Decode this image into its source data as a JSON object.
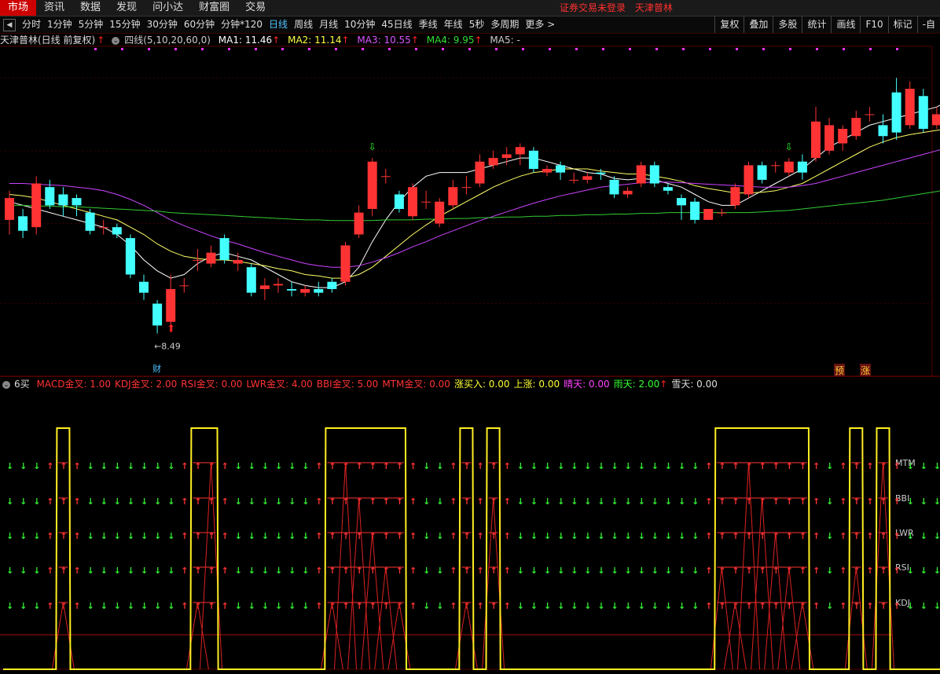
{
  "menu": {
    "items": [
      "市场",
      "资讯",
      "数据",
      "发现",
      "问小达",
      "财富圈",
      "交易"
    ],
    "active": 0,
    "notice_left": "证券交易未登录",
    "notice_right": "天津普林"
  },
  "toolbar": {
    "periods": [
      "分时",
      "1分钟",
      "5分钟",
      "15分钟",
      "30分钟",
      "60分钟",
      "分钟*120",
      "日线",
      "周线",
      "月线",
      "10分钟",
      "45日线",
      "季线",
      "年线",
      "5秒",
      "多周期",
      "更多 >"
    ],
    "active": "日线",
    "right_buttons": [
      "复权",
      "叠加",
      "多股",
      "统计",
      "画线",
      "F10",
      "标记",
      "-自"
    ]
  },
  "header": {
    "stock": "天津普林(日线 前复权)",
    "indicator": "四线(5,10,20,60,0)",
    "ma1": "MA1: 11.46",
    "ma2": "MA2: 11.14",
    "ma3": "MA3: 10.55",
    "ma4": "MA4: 9.95",
    "ma5": "MA5: -"
  },
  "sub_header": {
    "name": "6买",
    "fields": [
      {
        "text": "MACD金叉: 1.00",
        "color": "#ff3333"
      },
      {
        "text": "KDJ金叉: 2.00",
        "color": "#ff3333"
      },
      {
        "text": "RSI金叉: 0.00",
        "color": "#ff3333"
      },
      {
        "text": "LWR金叉: 4.00",
        "color": "#ff3333"
      },
      {
        "text": "BBI金叉: 5.00",
        "color": "#ff3333"
      },
      {
        "text": "MTM金叉: 0.00",
        "color": "#ff3333"
      },
      {
        "text": "涨买入: 0.00",
        "color": "#ffff33"
      },
      {
        "text": "上涨: 0.00",
        "color": "#ffff33"
      },
      {
        "text": "晴天: 0.00",
        "color": "#ff44ff"
      },
      {
        "text": "雨天: 2.00",
        "color": "#33ff33"
      },
      {
        "text": "雪天: 0.00",
        "color": "#dddddd"
      }
    ]
  },
  "annotations": {
    "high": "12.02",
    "low": "8.49",
    "cai": "财",
    "yu": "预",
    "zhang": "涨"
  },
  "sub_labels": [
    "MTM",
    "BBI",
    "LWR",
    "RSI",
    "KDJ"
  ],
  "chart_data": {
    "type": "candlestick",
    "ylim": [
      8.0,
      12.4
    ],
    "candles": [
      [
        10.05,
        10.35,
        10.45,
        9.85
      ],
      [
        10.1,
        9.9,
        10.2,
        9.8
      ],
      [
        9.95,
        10.55,
        10.65,
        9.85
      ],
      [
        10.5,
        10.25,
        10.6,
        10.2
      ],
      [
        10.4,
        10.25,
        10.5,
        10.1
      ],
      [
        10.35,
        10.25,
        10.4,
        10.1
      ],
      [
        10.15,
        9.9,
        10.2,
        9.85
      ],
      [
        9.95,
        9.95,
        10.05,
        9.85
      ],
      [
        9.95,
        9.85,
        10.0,
        9.8
      ],
      [
        9.8,
        9.3,
        9.85,
        9.25
      ],
      [
        9.2,
        9.05,
        9.3,
        8.95
      ],
      [
        8.9,
        8.6,
        8.95,
        8.49
      ],
      [
        8.65,
        9.1,
        9.3,
        8.6
      ],
      [
        9.15,
        9.15,
        9.25,
        9.05
      ],
      [
        9.5,
        9.5,
        9.65,
        9.35
      ],
      [
        9.45,
        9.6,
        9.7,
        9.4
      ],
      [
        9.8,
        9.5,
        9.85,
        9.45
      ],
      [
        9.45,
        9.5,
        9.6,
        9.35
      ],
      [
        9.4,
        9.05,
        9.45,
        9.0
      ],
      [
        9.1,
        9.15,
        9.25,
        8.95
      ],
      [
        9.15,
        9.17,
        9.25,
        9.05
      ],
      [
        9.1,
        9.08,
        9.2,
        9.0
      ],
      [
        9.05,
        9.1,
        9.15,
        9.0
      ],
      [
        9.1,
        9.05,
        9.2,
        9.0
      ],
      [
        9.2,
        9.1,
        9.25,
        9.05
      ],
      [
        9.2,
        9.7,
        9.75,
        9.15
      ],
      [
        9.85,
        10.15,
        10.25,
        9.8
      ],
      [
        10.2,
        10.85,
        10.9,
        10.1
      ],
      [
        10.65,
        10.65,
        10.75,
        10.55
      ],
      [
        10.4,
        10.2,
        10.45,
        10.15
      ],
      [
        10.1,
        10.5,
        10.55,
        10.05
      ],
      [
        10.3,
        10.3,
        10.45,
        10.2
      ],
      [
        10.0,
        10.3,
        10.35,
        9.95
      ],
      [
        10.25,
        10.5,
        10.6,
        10.2
      ],
      [
        10.5,
        10.5,
        10.65,
        10.4
      ],
      [
        10.55,
        10.85,
        10.95,
        10.5
      ],
      [
        10.8,
        10.9,
        11.0,
        10.75
      ],
      [
        10.9,
        10.95,
        11.05,
        10.8
      ],
      [
        10.95,
        11.05,
        11.1,
        10.8
      ],
      [
        11.0,
        10.75,
        11.05,
        10.7
      ],
      [
        10.7,
        10.75,
        10.8,
        10.65
      ],
      [
        10.8,
        10.7,
        10.85,
        10.6
      ],
      [
        10.6,
        10.6,
        10.7,
        10.55
      ],
      [
        10.6,
        10.65,
        10.7,
        10.55
      ],
      [
        10.7,
        10.68,
        10.75,
        10.6
      ],
      [
        10.6,
        10.4,
        10.65,
        10.35
      ],
      [
        10.4,
        10.45,
        10.5,
        10.35
      ],
      [
        10.55,
        10.8,
        10.85,
        10.5
      ],
      [
        10.8,
        10.55,
        10.85,
        10.5
      ],
      [
        10.5,
        10.45,
        10.55,
        10.4
      ],
      [
        10.35,
        10.25,
        10.4,
        10.05
      ],
      [
        10.3,
        10.05,
        10.35,
        10.0
      ],
      [
        10.05,
        10.2,
        10.2,
        10.05
      ],
      [
        10.15,
        10.15,
        10.2,
        10.1
      ],
      [
        10.25,
        10.5,
        10.55,
        10.2
      ],
      [
        10.4,
        10.8,
        10.85,
        10.35
      ],
      [
        10.8,
        10.6,
        10.85,
        10.55
      ],
      [
        10.8,
        10.8,
        10.85,
        10.7
      ],
      [
        10.7,
        10.85,
        10.9,
        10.65
      ],
      [
        10.85,
        10.7,
        10.95,
        10.6
      ],
      [
        10.9,
        11.4,
        11.6,
        10.85
      ],
      [
        11.0,
        11.35,
        11.45,
        10.95
      ],
      [
        11.1,
        11.3,
        11.35,
        11.0
      ],
      [
        11.2,
        11.45,
        11.55,
        11.15
      ],
      [
        11.5,
        11.5,
        11.6,
        11.4
      ],
      [
        11.35,
        11.2,
        11.5,
        11.1
      ],
      [
        11.8,
        11.25,
        12.0,
        11.15
      ],
      [
        11.35,
        11.85,
        11.95,
        11.3
      ],
      [
        11.75,
        11.3,
        11.85,
        11.25
      ],
      [
        11.35,
        11.5,
        11.6,
        11.3
      ],
      [
        11.6,
        12.02,
        12.02,
        11.55
      ],
      [
        11.9,
        11.75,
        12.0,
        11.6
      ],
      [
        11.7,
        11.6,
        11.9,
        11.5
      ]
    ],
    "ma": {
      "MA1": {
        "color": "#ffffff",
        "values": [
          10.3,
          10.25,
          10.2,
          10.15,
          10.1,
          10.05,
          10.0,
          9.95,
          9.85,
          9.7,
          9.5,
          9.35,
          9.25,
          9.3,
          9.45,
          9.55,
          9.6,
          9.55,
          9.5,
          9.4,
          9.3,
          9.2,
          9.15,
          9.12,
          9.12,
          9.2,
          9.4,
          9.75,
          10.05,
          10.3,
          10.5,
          10.65,
          10.7,
          10.7,
          10.7,
          10.75,
          10.8,
          10.85,
          10.9,
          10.9,
          10.85,
          10.8,
          10.75,
          10.7,
          10.68,
          10.62,
          10.6,
          10.62,
          10.6,
          10.55,
          10.5,
          10.4,
          10.3,
          10.25,
          10.25,
          10.35,
          10.45,
          10.55,
          10.65,
          10.75,
          10.9,
          11.05,
          11.15,
          11.25,
          11.35,
          11.4,
          11.45,
          11.5,
          11.55,
          11.6,
          11.7,
          11.75,
          11.75
        ]
      },
      "MA2": {
        "color": "#ffff66",
        "values": [
          10.4,
          10.38,
          10.35,
          10.3,
          10.25,
          10.2,
          10.15,
          10.1,
          10.05,
          9.95,
          9.85,
          9.72,
          9.62,
          9.55,
          9.52,
          9.5,
          9.5,
          9.48,
          9.45,
          9.42,
          9.38,
          9.35,
          9.3,
          9.28,
          9.25,
          9.25,
          9.3,
          9.4,
          9.55,
          9.7,
          9.85,
          9.98,
          10.1,
          10.2,
          10.3,
          10.4,
          10.5,
          10.58,
          10.65,
          10.7,
          10.72,
          10.75,
          10.75,
          10.75,
          10.72,
          10.7,
          10.68,
          10.68,
          10.65,
          10.62,
          10.58,
          10.52,
          10.48,
          10.45,
          10.42,
          10.42,
          10.43,
          10.45,
          10.5,
          10.55,
          10.65,
          10.75,
          10.85,
          10.95,
          11.05,
          11.12,
          11.18,
          11.22,
          11.25,
          11.28,
          11.3,
          11.35,
          11.4
        ]
      },
      "MA3": {
        "color": "#cc44ff",
        "values": [
          10.55,
          10.55,
          10.54,
          10.53,
          10.52,
          10.5,
          10.48,
          10.45,
          10.4,
          10.33,
          10.25,
          10.15,
          10.05,
          9.97,
          9.9,
          9.83,
          9.77,
          9.72,
          9.66,
          9.6,
          9.55,
          9.5,
          9.45,
          9.42,
          9.4,
          9.4,
          9.42,
          9.47,
          9.53,
          9.6,
          9.68,
          9.75,
          9.83,
          9.9,
          9.97,
          10.04,
          10.1,
          10.16,
          10.22,
          10.28,
          10.33,
          10.38,
          10.42,
          10.46,
          10.5,
          10.52,
          10.54,
          10.56,
          10.57,
          10.57,
          10.56,
          10.55,
          10.54,
          10.53,
          10.52,
          10.51,
          10.5,
          10.5,
          10.5,
          10.52,
          10.55,
          10.6,
          10.65,
          10.7,
          10.75,
          10.8,
          10.85,
          10.9,
          10.95,
          11.0,
          11.05,
          11.1,
          11.15
        ]
      },
      "MA4": {
        "color": "#33cc33",
        "values": [
          10.25,
          10.25,
          10.24,
          10.24,
          10.23,
          10.23,
          10.22,
          10.21,
          10.2,
          10.19,
          10.18,
          10.17,
          10.15,
          10.14,
          10.13,
          10.12,
          10.11,
          10.1,
          10.09,
          10.08,
          10.07,
          10.06,
          10.05,
          10.05,
          10.04,
          10.04,
          10.04,
          10.04,
          10.05,
          10.05,
          10.05,
          10.06,
          10.06,
          10.07,
          10.07,
          10.08,
          10.08,
          10.09,
          10.09,
          10.1,
          10.1,
          10.11,
          10.11,
          10.12,
          10.12,
          10.13,
          10.13,
          10.14,
          10.14,
          10.15,
          10.15,
          10.15,
          10.15,
          10.15,
          10.15,
          10.15,
          10.16,
          10.17,
          10.18,
          10.2,
          10.22,
          10.24,
          10.26,
          10.28,
          10.3,
          10.32,
          10.35,
          10.38,
          10.41,
          10.44,
          10.47,
          10.5,
          10.53
        ]
      }
    },
    "signals_yellow": [
      0,
      0,
      0,
      0,
      1,
      0,
      0,
      0,
      0,
      0,
      0,
      0,
      0,
      0,
      1,
      1,
      0,
      0,
      0,
      0,
      0,
      0,
      0,
      0,
      1,
      1,
      1,
      1,
      1,
      1,
      0,
      0,
      0,
      0,
      1,
      0,
      1,
      0,
      0,
      0,
      0,
      0,
      0,
      0,
      0,
      0,
      0,
      0,
      0,
      0,
      0,
      0,
      0,
      1,
      1,
      1,
      1,
      1,
      1,
      1,
      0,
      0,
      0,
      1,
      0,
      1,
      0,
      0,
      0,
      0,
      0,
      0,
      0
    ],
    "sub_ylim": [
      0,
      7
    ]
  }
}
